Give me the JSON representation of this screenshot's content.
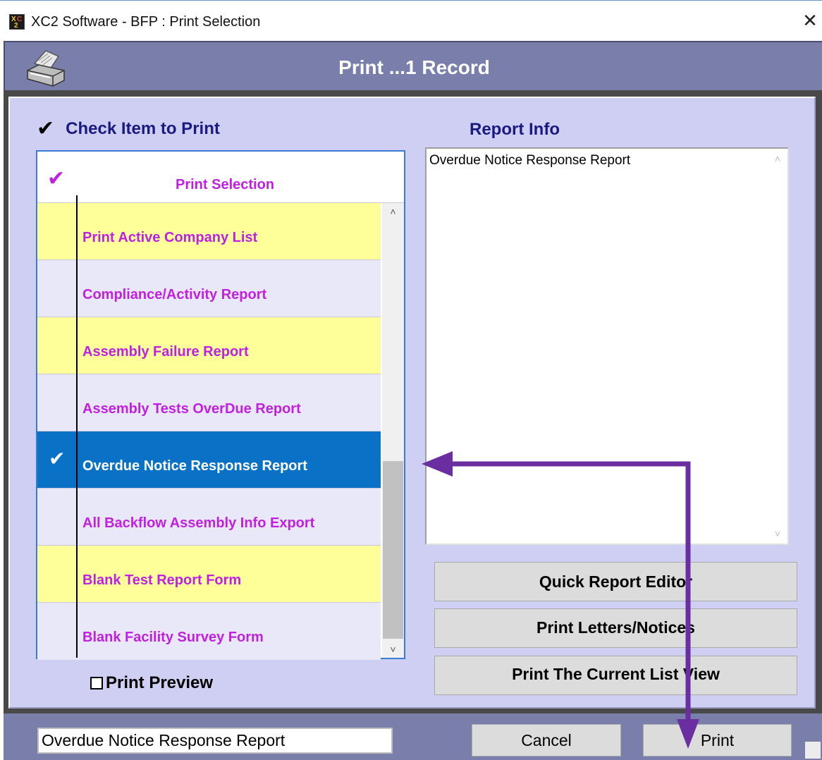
{
  "window": {
    "title": "XC2 Software - BFP : Print Selection",
    "close_glyph": "✕"
  },
  "header": {
    "title": "Print ...1 Record",
    "icon": "printer-icon"
  },
  "check_header": {
    "glyph": "✔",
    "label": "Check Item to Print"
  },
  "list": {
    "header_glyph": "✔",
    "header_label": "Print  Selection",
    "rows": [
      {
        "label": "Print Active Company List",
        "checked": false,
        "selected": false,
        "color": "yellow"
      },
      {
        "label": "Compliance/Activity  Report",
        "checked": false,
        "selected": false,
        "color": "lavender"
      },
      {
        "label": "Assembly Failure Report",
        "checked": false,
        "selected": false,
        "color": "yellow"
      },
      {
        "label": "Assembly Tests OverDue Report",
        "checked": false,
        "selected": false,
        "color": "lavender"
      },
      {
        "label": "Overdue Notice Response Report",
        "checked": true,
        "selected": true,
        "color": "blue",
        "glyph": "✔"
      },
      {
        "label": "All  Backflow Assembly Info Export",
        "checked": false,
        "selected": false,
        "color": "lavender"
      },
      {
        "label": "Blank Test Report Form",
        "checked": false,
        "selected": false,
        "color": "yellow"
      },
      {
        "label": "Blank Facility  Survey Form",
        "checked": false,
        "selected": false,
        "color": "lavender"
      }
    ],
    "scroll_up": "˄",
    "scroll_down": "˅"
  },
  "print_preview": {
    "label": "Print Preview",
    "checked": false
  },
  "report_info": {
    "title": "Report Info",
    "text": "Overdue Notice Response Report"
  },
  "buttons": {
    "quick_report_editor": "Quick Report Editor",
    "print_letters": "Print Letters/Notices",
    "print_list_view": "Print The Current List View",
    "cancel": "Cancel",
    "print": "Print"
  },
  "status_field": "Overdue Notice Response Report",
  "colors": {
    "header_band": "#7a7eaa",
    "panel": "#cfcff4",
    "row_yellow": "#ffff99",
    "row_lavender": "#e8e8f8",
    "row_selected": "#0a72c6",
    "item_text": "#c020e0",
    "heading_text": "#1a1a80",
    "annotation_arrow": "#6a2ea0"
  }
}
